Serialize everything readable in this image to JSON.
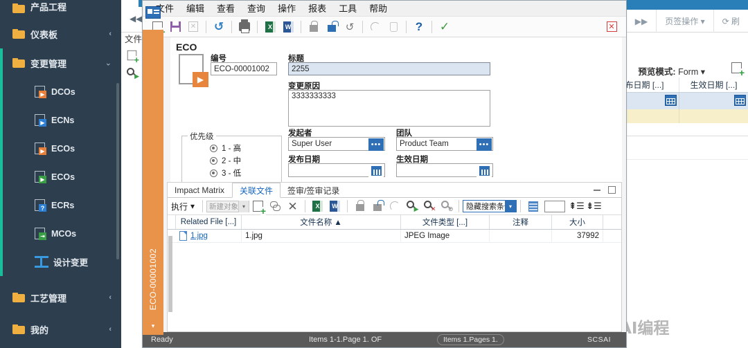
{
  "sidebar": {
    "items": [
      {
        "label": "产品工程",
        "type": "folder",
        "expand": ""
      },
      {
        "label": "仪表板",
        "type": "folder",
        "expand": "‹"
      },
      {
        "label": "变更管理",
        "type": "folder",
        "expand": "⌄",
        "active": true
      }
    ],
    "sub_items": [
      {
        "label": "DCOs",
        "icon": "doc-play-orange-icon",
        "badge": "▶"
      },
      {
        "label": "ECNs",
        "icon": "doc-play-blue-icon",
        "badge": "▶"
      },
      {
        "label": "ECOs",
        "icon": "doc-play-orange-icon",
        "badge": "▶"
      },
      {
        "label": "ECOs",
        "icon": "doc-play-green-icon",
        "badge": "▶"
      },
      {
        "label": "ECRs",
        "icon": "doc-question-blue-icon",
        "badge": "?"
      },
      {
        "label": "MCOs",
        "icon": "doc-arrow-green-icon",
        "badge": "⇥"
      },
      {
        "label": "设计变更",
        "icon": "ibeam-icon",
        "badge": ""
      }
    ],
    "bottom_items": [
      {
        "label": "工艺管理",
        "expand": "‹"
      },
      {
        "label": "我的",
        "expand": "‹"
      }
    ]
  },
  "background": {
    "collapse_icon": "◀◀",
    "file_label": "文件",
    "right_tools": [
      {
        "label": "▶▶",
        "name": "fast-forward-icon"
      },
      {
        "label": "页签操作 ▾",
        "name": "tab-actions-menu"
      },
      {
        "label": "⟳ 刷",
        "name": "refresh-button"
      }
    ],
    "preview_label": "预览模式:",
    "preview_value": "Form",
    "preview_caret": "▾",
    "grid_headers": [
      "布日期 [...]",
      "生效日期 [...]"
    ]
  },
  "watermark": {
    "text": "公众号 · AI智造AI编程"
  },
  "modal": {
    "menus": [
      "文件",
      "编辑",
      "查看",
      "查询",
      "操作",
      "报表",
      "工具",
      "帮助"
    ],
    "toolbar": [
      {
        "name": "new-document-button",
        "icon": "new-doc-icon",
        "title": "新建"
      },
      {
        "name": "save-button",
        "icon": "save-icon",
        "title": "保存"
      },
      {
        "name": "delete-button",
        "icon": "delete-doc-icon",
        "title": "删除"
      },
      {
        "name": "refresh-button",
        "icon": "refresh-icon",
        "title": "刷新"
      },
      {
        "name": "print-button",
        "icon": "print-icon",
        "title": "打印"
      },
      {
        "name": "export-excel-button",
        "icon": "excel-icon",
        "title": "Excel"
      },
      {
        "name": "export-word-button",
        "icon": "word-icon",
        "title": "Word"
      },
      {
        "name": "lock-button",
        "icon": "lock-icon",
        "title": "锁定"
      },
      {
        "name": "unlock-button",
        "icon": "unlock-icon",
        "title": "解锁"
      },
      {
        "name": "undo-button",
        "icon": "undo-icon",
        "title": "撤销"
      },
      {
        "name": "workflow-button",
        "icon": "arc-icon",
        "title": "流程"
      },
      {
        "name": "clipboard-button",
        "icon": "clipboard-icon",
        "title": "剪贴板"
      },
      {
        "name": "help-button",
        "icon": "question-icon",
        "title": "帮助"
      },
      {
        "name": "confirm-button",
        "icon": "check-icon",
        "title": "确认"
      }
    ],
    "close_icon_label": "✕",
    "form": {
      "object_type": "ECO",
      "number_label": "编号",
      "number_value": "ECO-00001002",
      "title_label": "标题",
      "title_value": "2255",
      "reason_label": "变更原因",
      "reason_value": "3333333333",
      "priority_group_label": "优先级",
      "priority_options": [
        "1 - 高",
        "2 - 中",
        "3 - 低"
      ],
      "initiator_label": "发起者",
      "initiator_value": "Super User",
      "team_label": "团队",
      "team_value": "Product Team",
      "release_date_label": "发布日期",
      "release_date_value": "",
      "effective_date_label": "生效日期",
      "effective_date_value": "",
      "ellipsis_btn": "•••"
    },
    "lower": {
      "tabs": [
        {
          "label": "Impact Matrix",
          "active": false
        },
        {
          "label": "关联文件",
          "active": true
        },
        {
          "label": "签审/签审记录",
          "active": false
        }
      ],
      "window_controls": {
        "minimize": "—",
        "maximize": "▢"
      },
      "grid_toolbar": {
        "exec_label": "执行",
        "exec_caret": "▾",
        "combo_placeholder": "新建对象",
        "combo_caret": "▾",
        "hide_condition_label": "隐藏搜索条件",
        "hide_condition_caret": "▾",
        "search_value": "",
        "buttons": [
          {
            "name": "add-file-button",
            "icon": "new-doc-plus-icon"
          },
          {
            "name": "link-button",
            "icon": "link-icon"
          },
          {
            "name": "remove-button",
            "icon": "x-icon"
          },
          {
            "name": "export-excel-button",
            "icon": "excel-icon"
          },
          {
            "name": "export-word-button",
            "icon": "word-icon"
          },
          {
            "name": "lock-button",
            "icon": "lock-icon"
          },
          {
            "name": "unlock-button",
            "icon": "unlock-icon"
          },
          {
            "name": "workflow-button",
            "icon": "arc-icon"
          },
          {
            "name": "search-run-button",
            "icon": "search-play-icon"
          },
          {
            "name": "search-clear-button",
            "icon": "search-x-icon"
          },
          {
            "name": "search-disable-button",
            "icon": "search-disabled-icon"
          }
        ]
      },
      "grid": {
        "columns": [
          "Related File [...]",
          "文件名称 ▲",
          "文件类型 [...]",
          "注释",
          "大小"
        ],
        "rows": [
          {
            "related_file": "1.jpg",
            "file_name": "1.jpg",
            "file_type": "JPEG Image",
            "comment": "",
            "size": "37992"
          }
        ]
      }
    },
    "vertical_tab": {
      "label": "ECO-00001002",
      "caret": "▾"
    },
    "statusbar": {
      "ready": "Ready",
      "items": "Items 1-1.Page 1. OF",
      "pill": "Items 1.Pages 1.",
      "right": "SCSAI"
    }
  }
}
